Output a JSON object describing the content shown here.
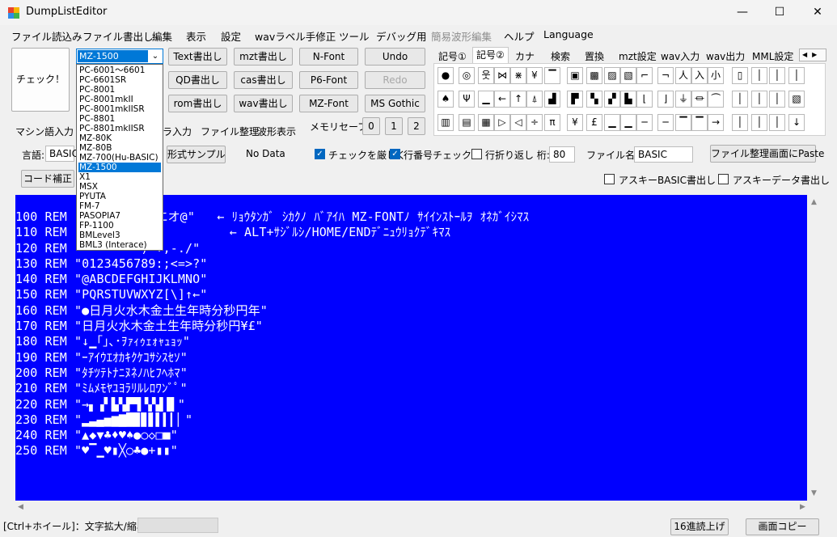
{
  "window": {
    "title": "DumpListEditor",
    "minimize": "—",
    "maximize": "☐",
    "close": "✕"
  },
  "menu": [
    "ファイル読込み",
    "ファイル書出し",
    "編集",
    "表示",
    "設定",
    "wavラベル手修正",
    "ツール",
    "デバッグ用",
    "簡易波形編集",
    "ヘルプ",
    "Language"
  ],
  "left": {
    "check_button": "チェック！",
    "combo_value": "MZ-1500",
    "combo_options": [
      "PC-6001～6601",
      "PC-6601SR",
      "PC-8001",
      "PC-8001mkII",
      "PC-8001mkIISR",
      "PC-8801",
      "PC-8801mkIISR",
      "MZ-80K",
      "MZ-80B",
      "MZ-700(Hu-BASIC)",
      "MZ-1500",
      "X1",
      "MSX",
      "PYUTA",
      "FM-7",
      "PASOPIA7",
      "FP-1100",
      "BMLevel3",
      "BML3 (Interace)"
    ],
    "selected_option_index": 10
  },
  "buttons": {
    "text_out": "Text書出し",
    "qd_out": "QD書出し",
    "rom_out": "rom書出し",
    "mzt_out": "mzt書出し",
    "cas_out": "cas書出し",
    "wav_out": "wav書出し",
    "nfont": "N-Font",
    "p6font": "P6-Font",
    "mzfont": "MZ-Font",
    "undo": "Undo",
    "redo": "Redo",
    "msgothic": "MS Gothic"
  },
  "memory_save": {
    "label": "メモリセーブ:",
    "slots": [
      "0",
      "1",
      "2"
    ]
  },
  "left_tabs": [
    "マシン語入力",
    "ラ入力",
    "ファイル整理",
    "波形表示"
  ],
  "symbol_tabs": [
    "記号①",
    "記号②",
    "カナ",
    "検索",
    "置換",
    "mzt設定",
    "wav入力",
    "wav出力",
    "MML設定"
  ],
  "symbol_tab_active_index": 1,
  "symbol_rows": [
    [
      "●",
      "◎",
      "웃",
      "⋈",
      "⋇",
      "¥",
      "▔",
      "▣",
      "▩",
      "▨",
      "▧",
      "⌐",
      "¬",
      "⼈",
      "⼊",
      "⼩",
      "▯",
      "│",
      "│",
      "│"
    ],
    [
      "♠",
      "Ψ",
      "▁",
      "←",
      "↑",
      "⍋",
      "▟",
      "▛",
      "▚",
      "▞",
      "▙",
      "⌊",
      "⌋",
      "⏚",
      "⏛",
      "⏜",
      "│",
      "│",
      "│",
      "▧"
    ],
    [
      "▥",
      "▤",
      "▦",
      "▷",
      "◁",
      "÷",
      "π",
      "¥",
      "£",
      "▁",
      "▁",
      "─",
      "─",
      "▔",
      "▔",
      "→",
      "│",
      "│",
      "│",
      "↓"
    ]
  ],
  "options": {
    "lang_label": "言語:",
    "lang_value": "BASIC",
    "code_fix_button": "コード補正",
    "format_sample_button": "形式サンプル",
    "no_data": "No Data",
    "strict_check": "チェックを厳しく",
    "line_number_check": "行番号チェック",
    "wrap_label": "行折り返し 桁:",
    "wrap_cols": "80",
    "filename_label": "ファイル名:",
    "filename_value": "BASIC",
    "paste_button": "ファイル整理画面にPaste",
    "ascii_basic_out": "アスキーBASIC書出し",
    "ascii_data_out": "アスキーデータ書出し"
  },
  "code_lines": [
    "100 REM \"!\"#$%&'()*エオ@\"   ← ﾘｮｳﾀﾝｶﾞ ｼｶｸﾉ ﾊﾞｱｲﾊ MZ-FONTﾉ ｻｲｲﾝｽﾄｰﾙｦ ｵﾈｶﾞｲｼﾏｽ",
    "110 REM \"                    ← ALT+ｻｼﾞﾙｼ/HOME/ENDﾃﾞﾆｭｳﾘｮｸﾃﾞｷﾏｽ",
    "120 REM \"        )*+,-./\"",
    "130 REM \"0123456789:;<=>?\"",
    "140 REM \"@ABCDEFGHIJKLMNO\"",
    "150 REM \"PQRSTUVWXYZ[\\]↑←\"",
    "160 REM \"●日月火水木金土生年時分秒円年\"",
    "170 REM \"日月火水木金土生年時分秒円¥£\"",
    "180 REM \"↓▁｢｣､･ｦｧｨｩｪｫｬｭｮｯ\"",
    "190 REM \"ｰｱｲｳｴｵｶｷｸｹｺｻｼｽｾｿ\"",
    "200 REM \"ﾀﾁﾂﾃﾄﾅﾆﾇﾈﾉﾊﾋﾌﾍﾎﾏ\"",
    "210 REM \"ﾐﾑﾒﾓﾔﾕﾖﾗﾘﾙﾚﾛﾜﾝﾞﾟ\"",
    "220 REM \"→▖▗▘▙▚▛▜▝▞▟▐▌\"",
    "230 REM \"▂▃▄▅▆▇█▉▊▋▌▍▎▏\"",
    "240 REM \"▲◆▼♣♦♥♠●○◇□■\"",
    "250 REM \"♥▔▁♥▮╳○♣●+▮▮\""
  ],
  "status": {
    "hint": "[Ctrl+ホイール]：文字拡大/縮小",
    "hex_read": "16進読上げ",
    "screen_copy": "画面コピー"
  }
}
